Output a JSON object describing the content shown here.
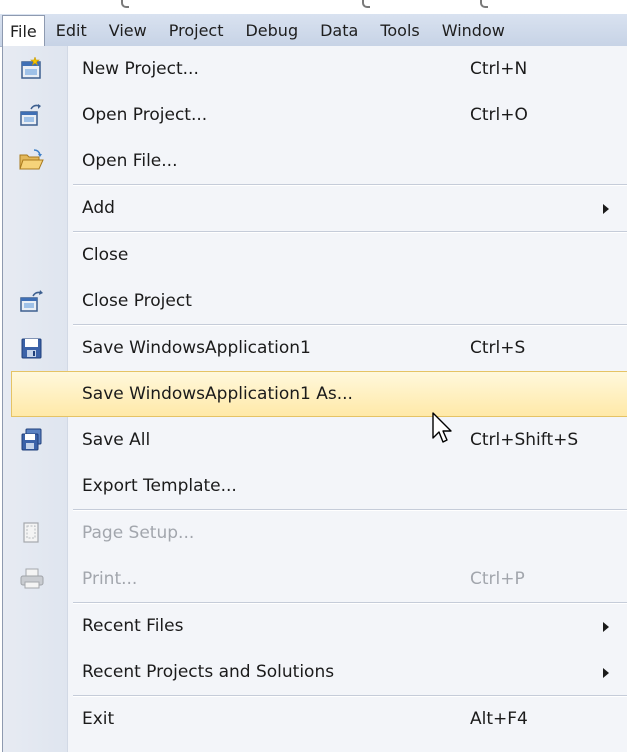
{
  "menubar": {
    "items": [
      {
        "label": "File",
        "active": true
      },
      {
        "label": "Edit"
      },
      {
        "label": "View"
      },
      {
        "label": "Project"
      },
      {
        "label": "Debug"
      },
      {
        "label": "Data"
      },
      {
        "label": "Tools"
      },
      {
        "label": "Window"
      }
    ]
  },
  "file_menu": {
    "items": [
      {
        "label": "New Project...",
        "shortcut": "Ctrl+N",
        "icon": "new-project-icon"
      },
      {
        "label": "Open Project...",
        "shortcut": "Ctrl+O",
        "icon": "open-project-icon"
      },
      {
        "label": "Open File...",
        "shortcut": "",
        "icon": "open-file-icon"
      },
      {
        "label": "Add",
        "shortcut": "",
        "submenu": true
      },
      {
        "label": "Close",
        "shortcut": ""
      },
      {
        "label": "Close Project",
        "shortcut": "",
        "icon": "close-project-icon"
      },
      {
        "label": "Save WindowsApplication1",
        "shortcut": "Ctrl+S",
        "icon": "save-icon"
      },
      {
        "label": "Save WindowsApplication1 As...",
        "shortcut": "",
        "highlighted": true
      },
      {
        "label": "Save All",
        "shortcut": "Ctrl+Shift+S",
        "icon": "save-all-icon"
      },
      {
        "label": "Export Template...",
        "shortcut": ""
      },
      {
        "label": "Page Setup...",
        "shortcut": "",
        "disabled": true,
        "icon": "page-setup-icon"
      },
      {
        "label": "Print...",
        "shortcut": "Ctrl+P",
        "disabled": true,
        "icon": "print-icon"
      },
      {
        "label": "Recent Files",
        "shortcut": "",
        "submenu": true
      },
      {
        "label": "Recent Projects and Solutions",
        "shortcut": "",
        "submenu": true
      },
      {
        "label": "Exit",
        "shortcut": "Alt+F4"
      }
    ]
  },
  "colors": {
    "menubar_bg": "#d0dbeb",
    "highlight_bg": "#ffe9a8",
    "highlight_border": "#e5c365",
    "disabled_text": "#a2a6ad"
  }
}
